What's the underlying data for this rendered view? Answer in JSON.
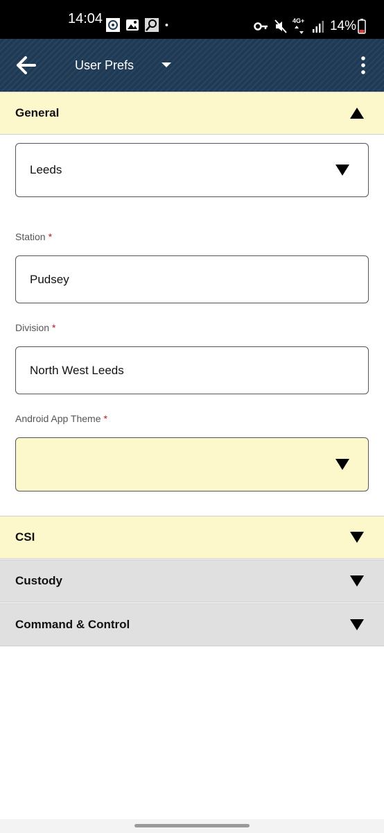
{
  "status_bar": {
    "time": "14:04",
    "battery_percent": "14%",
    "network_type": "4G+",
    "left_icons": [
      "police-badge-icon",
      "image-icon",
      "search-icon",
      "dot-icon"
    ],
    "right_icons": [
      "vpn-key-icon",
      "mute-icon",
      "network-icon",
      "signal-icon",
      "battery-icon"
    ],
    "battery_low_color": "#e53935"
  },
  "app_bar": {
    "title": "User Prefs",
    "color": "#1f3a55"
  },
  "sections": {
    "general": {
      "label": "General",
      "expanded": true
    },
    "csi": {
      "label": "CSI",
      "expanded": false
    },
    "custody": {
      "label": "Custody",
      "expanded": false
    },
    "command_control": {
      "label": "Command & Control",
      "expanded": false
    }
  },
  "general_fields": {
    "area_select": {
      "value": "Leeds"
    },
    "station": {
      "label": "Station",
      "required_mark": "*",
      "value": "Pudsey"
    },
    "division": {
      "label": "Division",
      "required_mark": "*",
      "value": "North West Leeds"
    },
    "theme": {
      "label": "Android App Theme",
      "required_mark": "*",
      "value": ""
    }
  },
  "colors": {
    "highlight_yellow": "#fdf7cc",
    "collapsed_grey": "#e0e0e0",
    "required_red": "#c0151f"
  }
}
